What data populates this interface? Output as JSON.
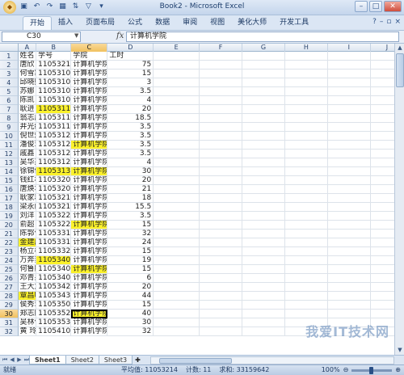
{
  "window": {
    "title": "Book2 - Microsoft Excel",
    "qat_icons": [
      "office-button-icon",
      "save-icon",
      "undo-icon",
      "redo-icon",
      "table-icon",
      "sort-icon",
      "filter-icon",
      "more-icon"
    ]
  },
  "ribbon": {
    "tabs": [
      "开始",
      "插入",
      "页面布局",
      "公式",
      "数据",
      "审阅",
      "视图",
      "美化大师",
      "开发工具"
    ],
    "active_tab": "开始"
  },
  "formula_bar": {
    "name_box": "C30",
    "fx_label": "fx",
    "content": "计算机学院"
  },
  "columns": [
    "A",
    "B",
    "C",
    "D",
    "E",
    "F",
    "G",
    "H",
    "I",
    "J"
  ],
  "selected_column": "C",
  "rows": [
    {
      "n": "1",
      "a": "姓名",
      "b": "学号",
      "c": "学院",
      "d": "工时",
      "hl_b": false,
      "hl_c": false,
      "hl_a": false
    },
    {
      "n": "2",
      "a": "唐欣",
      "b": "11053218",
      "c": "计算机学院",
      "d": "75"
    },
    {
      "n": "3",
      "a": "何雪霜",
      "b": "11053102",
      "c": "计算机学院",
      "d": "15"
    },
    {
      "n": "4",
      "a": "邱晓熙",
      "b": "11053105",
      "c": "计算机学院",
      "d": "3"
    },
    {
      "n": "5",
      "a": "苏娜",
      "b": "11053106",
      "c": "计算机学院",
      "d": "3.5"
    },
    {
      "n": "6",
      "a": "陈凯",
      "b": "11053108",
      "c": "计算机学院",
      "d": "4"
    },
    {
      "n": "7",
      "a": "耿进",
      "b": "11053110",
      "c": "计算机学院",
      "d": "20",
      "hl_b": true
    },
    {
      "n": "8",
      "a": "翁志成",
      "b": "11053113",
      "c": "计算机学院",
      "d": "18.5"
    },
    {
      "n": "9",
      "a": "井光绪",
      "b": "11053114",
      "c": "计算机学院",
      "d": "3.5"
    },
    {
      "n": "10",
      "a": "倪世斌",
      "b": "11053121",
      "c": "计算机学院",
      "d": "3.5"
    },
    {
      "n": "11",
      "a": "潘俊玮",
      "b": "11053122",
      "c": "计算机学院",
      "d": "3.5",
      "hl_c": true
    },
    {
      "n": "12",
      "a": "戚鑫",
      "b": "11053124",
      "c": "计算机学院",
      "d": "3.5"
    },
    {
      "n": "13",
      "a": "吴华杰",
      "b": "11053128",
      "c": "计算机学院",
      "d": "4"
    },
    {
      "n": "14",
      "a": "徐锦健",
      "b": "11053130",
      "c": "计算机学院",
      "d": "30",
      "hl_b": true,
      "hl_c": true
    },
    {
      "n": "15",
      "a": "钱红林",
      "b": "11053203",
      "c": "计算机学院",
      "d": "20"
    },
    {
      "n": "16",
      "a": "唐焕圻",
      "b": "11053205",
      "c": "计算机学院",
      "d": "21"
    },
    {
      "n": "17",
      "a": "耿家利",
      "b": "11053212",
      "c": "计算机学院",
      "d": "18"
    },
    {
      "n": "18",
      "a": "梁永彪",
      "b": "11053219",
      "c": "计算机学院",
      "d": "15.5"
    },
    {
      "n": "19",
      "a": "刘洋",
      "b": "11053222",
      "c": "计算机学院",
      "d": "3.5"
    },
    {
      "n": "20",
      "a": "俞超",
      "b": "11053226",
      "c": "计算机学院",
      "d": "15",
      "hl_c": true
    },
    {
      "n": "21",
      "a": "陈郭伟",
      "b": "11053310",
      "c": "计算机学院",
      "d": "32"
    },
    {
      "n": "22",
      "a": "金建成",
      "b": "11053316",
      "c": "计算机学院",
      "d": "24",
      "hl_a": true
    },
    {
      "n": "23",
      "a": "杨立彬",
      "b": "11053324",
      "c": "计算机学院",
      "d": "15"
    },
    {
      "n": "24",
      "a": "万奔奔",
      "b": "11053402",
      "c": "计算机学院",
      "d": "19",
      "hl_b": true
    },
    {
      "n": "25",
      "a": "何鲁鹏",
      "b": "11053403",
      "c": "计算机学院",
      "d": "15",
      "hl_c": true
    },
    {
      "n": "26",
      "a": "邓青果",
      "b": "11053408",
      "c": "计算机学院",
      "d": "6"
    },
    {
      "n": "27",
      "a": "王大龙",
      "b": "11053424",
      "c": "计算机学院",
      "d": "20"
    },
    {
      "n": "28",
      "a": "覃昌明",
      "b": "11053435",
      "c": "计算机学院",
      "d": "44",
      "hl_a": true
    },
    {
      "n": "29",
      "a": "侯秀玲",
      "b": "11053508",
      "c": "计算机学院",
      "d": "15"
    },
    {
      "n": "30",
      "a": "郑志胜",
      "b": "11053529",
      "c": "计算机学院",
      "d": "40",
      "hl_c": true,
      "active_c": true
    },
    {
      "n": "31",
      "a": "吴林俊",
      "b": "11053539",
      "c": "计算机学院",
      "d": "30"
    },
    {
      "n": "32",
      "a": "黄 玲",
      "b": "11054103",
      "c": "计算机学院",
      "d": "32"
    }
  ],
  "sheets": [
    "Sheet1",
    "Sheet2",
    "Sheet3"
  ],
  "active_sheet": "Sheet1",
  "status": {
    "mode": "就绪",
    "average": "平均值: 11053214",
    "count": "计数: 11",
    "sum": "求和: 33159642",
    "zoom": "100%"
  },
  "watermark": "我爱IT技术网"
}
